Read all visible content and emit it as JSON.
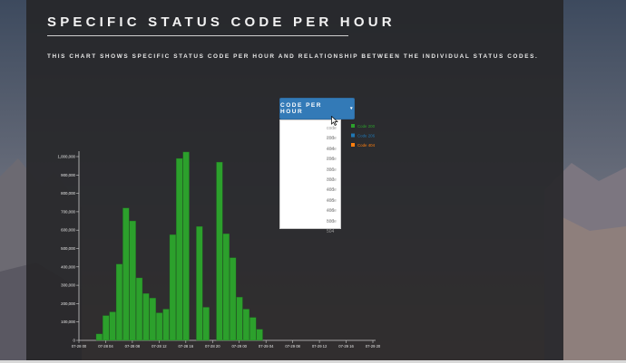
{
  "page": {
    "title": "SPECIFIC STATUS CODE PER HOUR",
    "subtitle": "THIS CHART SHOWS SPECIFIC STATUS CODE PER HOUR AND RELATIONSHIP BETWEEN THE INDIVIDUAL STATUS CODES."
  },
  "dropdown": {
    "label": "CODE PER HOUR",
    "caret": "▾",
    "options": [
      "code 200",
      "code 404",
      "code 206",
      "code 301",
      "code 302",
      "code 403",
      "code 405",
      "code 406",
      "code 500",
      "code 504"
    ]
  },
  "legend": [
    {
      "label": "Code 200",
      "color": "#2ca02c"
    },
    {
      "label": "Code 206",
      "color": "#1f77b4"
    },
    {
      "label": "Code 404",
      "color": "#ff7f0e"
    }
  ],
  "chart_data": {
    "type": "bar",
    "series": [
      {
        "name": "Code 200",
        "color": "#2ca02c",
        "values": [
          35000,
          135000,
          155000,
          415000,
          720000,
          650000,
          340000,
          255000,
          230000,
          150000,
          170000,
          575000,
          990000,
          1025000,
          0,
          620000,
          180000,
          0,
          970000,
          580000,
          450000,
          235000,
          170000,
          125000,
          60000,
          0,
          0,
          0,
          0,
          0,
          0,
          0,
          0,
          0,
          0,
          0,
          0,
          0,
          0,
          0,
          0,
          0,
          0,
          0,
          0
        ]
      }
    ],
    "xticks": [
      "07-28 00",
      "07-28 04",
      "07-28 08",
      "07-28 12",
      "07-28 16",
      "07-28 20",
      "07-29 00",
      "07-29 04",
      "07-29 08",
      "07-29 12",
      "07-29 16",
      "07-29 20"
    ],
    "yticks": [
      "0",
      "100,000",
      "200,000",
      "300,000",
      "400,000",
      "500,000",
      "600,000",
      "700,000",
      "800,000",
      "900,000",
      "1,000,000"
    ],
    "ylim": [
      0,
      1000000
    ],
    "grid": false,
    "legend_position": "top-right"
  }
}
